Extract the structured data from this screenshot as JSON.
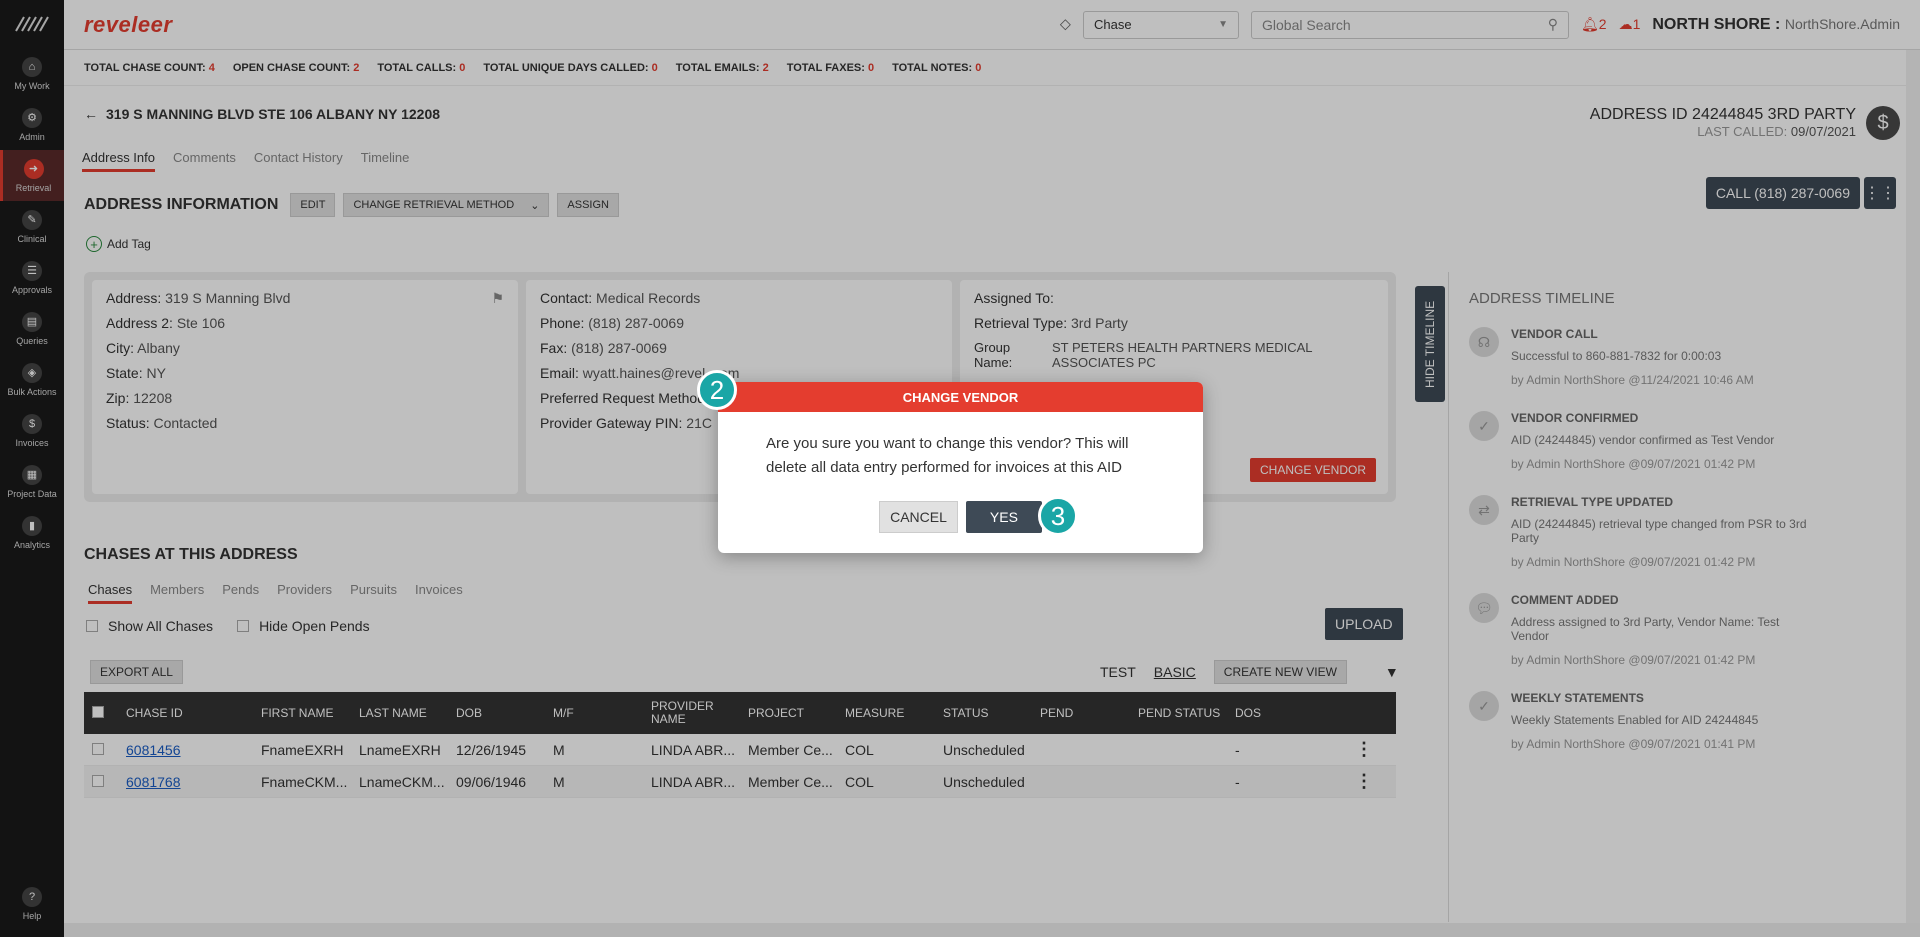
{
  "sidebar": {
    "items": [
      {
        "label": "My Work",
        "icon": "home-icon"
      },
      {
        "label": "Admin",
        "icon": "admin-icon"
      },
      {
        "label": "Retrieval",
        "icon": "retrieval-icon"
      },
      {
        "label": "Clinical",
        "icon": "clinical-icon"
      },
      {
        "label": "Approvals",
        "icon": "approvals-icon"
      },
      {
        "label": "Queries",
        "icon": "queries-icon"
      },
      {
        "label": "Bulk Actions",
        "icon": "bulk-actions-icon"
      },
      {
        "label": "Invoices",
        "icon": "invoices-icon"
      },
      {
        "label": "Project Data",
        "icon": "project-data-icon"
      },
      {
        "label": "Analytics",
        "icon": "analytics-icon"
      }
    ],
    "help": "Help"
  },
  "topbar": {
    "brand": "reveleer",
    "chase_select": "Chase",
    "search_placeholder": "Global Search",
    "alerts_count": "2",
    "cloud_count": "1",
    "org": "NORTH SHORE :",
    "user": "NorthShore.Admin"
  },
  "stats": [
    {
      "label": "TOTAL CHASE COUNT:",
      "value": "4"
    },
    {
      "label": "OPEN CHASE COUNT:",
      "value": "2"
    },
    {
      "label": "TOTAL CALLS:",
      "value": "0"
    },
    {
      "label": "TOTAL UNIQUE DAYS CALLED:",
      "value": "0"
    },
    {
      "label": "TOTAL EMAILS:",
      "value": "2"
    },
    {
      "label": "TOTAL FAXES:",
      "value": "0"
    },
    {
      "label": "TOTAL NOTES:",
      "value": "0"
    }
  ],
  "header": {
    "address": "319 S MANNING BLVD STE 106 ALBANY NY 12208",
    "address_id": "ADDRESS ID 24244845 3RD PARTY",
    "last_called_label": "LAST CALLED:",
    "last_called": "09/07/2021"
  },
  "tabs": [
    "Address Info",
    "Comments",
    "Contact History",
    "Timeline"
  ],
  "section": {
    "title": "ADDRESS INFORMATION",
    "edit": "EDIT",
    "change_method": "CHANGE RETRIEVAL METHOD",
    "assign": "ASSIGN",
    "call": "CALL (818) 287-0069",
    "add_tag": "Add Tag"
  },
  "card1": [
    {
      "label": "Address:",
      "value": "319 S Manning Blvd"
    },
    {
      "label": "Address 2:",
      "value": "Ste 106"
    },
    {
      "label": "City:",
      "value": "Albany"
    },
    {
      "label": "State:",
      "value": "NY"
    },
    {
      "label": "Zip:",
      "value": "12208"
    },
    {
      "label": "Status:",
      "value": "Contacted"
    }
  ],
  "card2": [
    {
      "label": "Contact:",
      "value": "Medical Records"
    },
    {
      "label": "Phone:",
      "value": "(818) 287-0069"
    },
    {
      "label": "Fax:",
      "value": "(818) 287-0069"
    },
    {
      "label": "Email:",
      "value": "wyatt.haines@revel   .com"
    },
    {
      "label": "Preferred Request Method",
      "value": ""
    },
    {
      "label": "Provider Gateway PIN:",
      "value": "21C"
    }
  ],
  "card3": {
    "assigned_label": "Assigned To:",
    "type_label": "Retrieval Type:",
    "type_value": "3rd Party",
    "group_label": "Group Name:",
    "group_value": "ST PETERS HEALTH PARTNERS MEDICAL ASSOCIATES PC",
    "change_vendor": "CHANGE VENDOR"
  },
  "timeline": {
    "tab": "HIDE TIMELINE",
    "title": "ADDRESS TIMELINE",
    "items": [
      {
        "title": "VENDOR CALL",
        "desc": "Successful to 860-881-7832 for 0:00:03",
        "by": "by Admin NorthShore @11/24/2021 10:46 AM",
        "icon": "headset-icon"
      },
      {
        "title": "VENDOR CONFIRMED",
        "desc": "AID (24244845) vendor confirmed as Test Vendor",
        "by": "by Admin NorthShore @09/07/2021 01:42 PM",
        "icon": "check-icon"
      },
      {
        "title": "RETRIEVAL TYPE UPDATED",
        "desc": "AID (24244845) retrieval type changed from PSR to 3rd Party",
        "by": "by Admin NorthShore @09/07/2021 01:42 PM",
        "icon": "swap-icon"
      },
      {
        "title": "COMMENT ADDED",
        "desc": "Address assigned to 3rd Party, Vendor Name: Test Vendor",
        "by": "by Admin NorthShore @09/07/2021 01:42 PM",
        "icon": "comment-icon"
      },
      {
        "title": "WEEKLY STATEMENTS",
        "desc": "Weekly Statements Enabled for AID 24244845",
        "by": "by Admin NorthShore @09/07/2021 01:41 PM",
        "icon": "check-icon"
      }
    ]
  },
  "chases": {
    "title": "CHASES AT THIS ADDRESS",
    "tabs": [
      "Chases",
      "Members",
      "Pends",
      "Providers",
      "Pursuits",
      "Invoices"
    ],
    "show_all": "Show All Chases",
    "hide_open": "Hide Open Pends",
    "upload": "UPLOAD",
    "export": "EXPORT ALL",
    "view_test": "TEST",
    "view_basic": "BASIC",
    "new_view": "CREATE NEW VIEW",
    "columns": [
      "CHASE ID",
      "FIRST NAME",
      "LAST NAME",
      "DOB",
      "M/F",
      "PROVIDER NAME",
      "PROJECT",
      "MEASURE",
      "STATUS",
      "PEND",
      "PEND STATUS",
      "DOS"
    ],
    "rows": [
      [
        "6081456",
        "FnameEXRH",
        "LnameEXRH",
        "12/26/1945",
        "M",
        "LINDA ABR...",
        "Member Ce...",
        "COL",
        "Unscheduled",
        "",
        "",
        "-"
      ],
      [
        "6081768",
        "FnameCKM...",
        "LnameCKM...",
        "09/06/1946",
        "M",
        "LINDA ABR...",
        "Member Ce...",
        "COL",
        "Unscheduled",
        "",
        "",
        "-"
      ]
    ]
  },
  "modal": {
    "title": "CHANGE VENDOR",
    "body": "Are you sure you want to change this vendor? This will delete all data entry performed for invoices at this AID",
    "cancel": "CANCEL",
    "yes": "YES"
  },
  "steps": {
    "two": "2",
    "three": "3"
  },
  "colors": {
    "accent": "#e43d2f",
    "dark": "#3e4a56",
    "teal": "#1aa6a6"
  }
}
